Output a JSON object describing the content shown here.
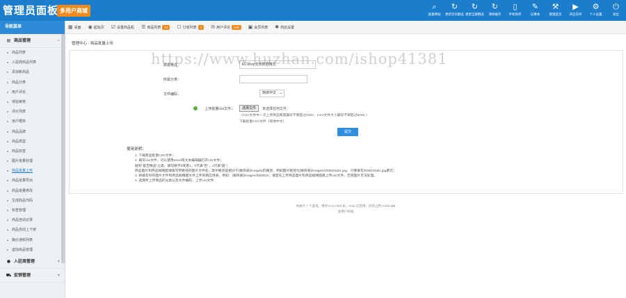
{
  "brand": {
    "title": "管理员面板",
    "badge": "多用户商城"
  },
  "topnav": [
    {
      "icon": "⌕",
      "icon_name": "search-icon",
      "label": "查看网站"
    },
    {
      "icon": "↻",
      "icon_name": "refresh-icon",
      "label": "更新页页静态"
    },
    {
      "icon": "↻",
      "icon_name": "refresh-icon",
      "label": "更新全部静态"
    },
    {
      "icon": "↻",
      "icon_name": "refresh-icon",
      "label": "清除缓存"
    },
    {
      "icon": "▯",
      "icon_name": "mobile-icon",
      "label": "手机商存"
    },
    {
      "icon": "✎",
      "icon_name": "notepad-icon",
      "label": "记事本"
    },
    {
      "icon": "⚒",
      "icon_name": "wrench-icon",
      "label": "管理首页"
    },
    {
      "icon": "▶",
      "icon_name": "play-icon",
      "label": "开启向导"
    },
    {
      "icon": "⚙",
      "icon_name": "gear-icon",
      "label": "个人设置"
    },
    {
      "icon": "⏻",
      "icon_name": "power-icon",
      "label": "退出"
    }
  ],
  "sidebar": {
    "header": "导航菜单",
    "groups": [
      {
        "icon": "▤",
        "icon_name": "list-icon",
        "label": "商品管理",
        "toggle": "−"
      },
      {
        "icon": "●",
        "icon_name": "store-icon",
        "label": "入驻商管理",
        "toggle": "+"
      },
      {
        "icon": "⛟",
        "icon_name": "cart-icon",
        "label": "促销管理",
        "toggle": "+"
      }
    ],
    "items": [
      "商品列表",
      "入驻商商品列表",
      "添加新商品",
      "商品分类",
      "用户评论",
      "待验审核",
      "评价列表",
      "用户晒单",
      "商品品牌",
      "商品类型",
      "商品标签",
      "图片批量处理",
      "商品批量上传",
      "商品批量导出",
      "商品批量修改",
      "生成商品代码",
      "标签管理",
      "商品自动记录",
      "商品自动上下架",
      "降价通知列表",
      "虚拟商品管理"
    ],
    "active_index": 12
  },
  "toolbar": [
    {
      "icon": "▦",
      "icon_name": "grid-icon",
      "label": "桌面",
      "badge": ""
    },
    {
      "icon": "◉",
      "icon_name": "clock-icon",
      "label": "起始页",
      "badge": ""
    },
    {
      "icon": "☑",
      "icon_name": "checkbox-icon",
      "label": "设置商品机",
      "badge": ""
    },
    {
      "icon": "☰",
      "icon_name": "list-icon",
      "label": "商品列表",
      "badge": "41"
    },
    {
      "icon": "☐",
      "icon_name": "order-icon",
      "label": "订单列表",
      "badge": "2"
    },
    {
      "icon": "✉",
      "icon_name": "comment-icon",
      "label": "用户评论",
      "badge": "149"
    },
    {
      "icon": "▣",
      "icon_name": "member-icon",
      "label": "会员列表",
      "badge": ""
    },
    {
      "icon": "✱",
      "icon_name": "settings-icon",
      "label": "商店设置",
      "badge": ""
    }
  ],
  "breadcrumb": "管理中心 - 商品批量上传",
  "form": {
    "format_label": "数据格式：",
    "format_value": "ECShop支持数据格式",
    "category_label": "所属分类：",
    "category_value": "",
    "encoding_label": "文件编码：",
    "encoding_value": "简体中文",
    "upload_label": "上传批量csv文件：",
    "file_button": "选择文件",
    "file_status": "未选择任何文件",
    "upload_hint": "（CSV文件中一次上传商品数量最好不要超过1000，CSV文件大小最好不要超过500K.）",
    "format_hint": "下载批量CSV文件（简体中文）",
    "submit_label": "提交"
  },
  "usage": {
    "title": "使用说明：",
    "lines": [
      "1. 下载商品批量CSV文件；",
      "2. 填写csv文件，可以使用excel或文本编辑器打开csv文件；",
      "   碰到\"是否精品\"之类，填写数字0或者1，0代表\"否\"，1代表\"是\"；",
      "   商品图片和商品缩略图请填写带路径的图片文件名，其中路径是相对于[根目录]/images/的路径，例如图片路径为[根目录]/images/200610/abc.jpg，只要填写200610/abc.jpg即可；",
      "3. 将填写好的图片文件和商品缩略图文件上传到相应目录，例如：[根目录]/images/200610/；请首先上传商品图片和商品缩略图再上传csv文件，否则图片无法处理。",
      "4. 选择所上传商品的分类以及文件编码，上传csv文件"
    ]
  },
  "footer": {
    "line1": "共执行 7 个查询，用时 0.017350 秒，Gzip 已禁用，内存占用 3.593 MB",
    "line2": "多用户商城"
  },
  "watermark": "https://www.huzhan.com/ishop41381",
  "colors": {
    "topbar": "#1d7dcd",
    "badge": "#f08a1c",
    "submit": "#2f8ee0"
  }
}
